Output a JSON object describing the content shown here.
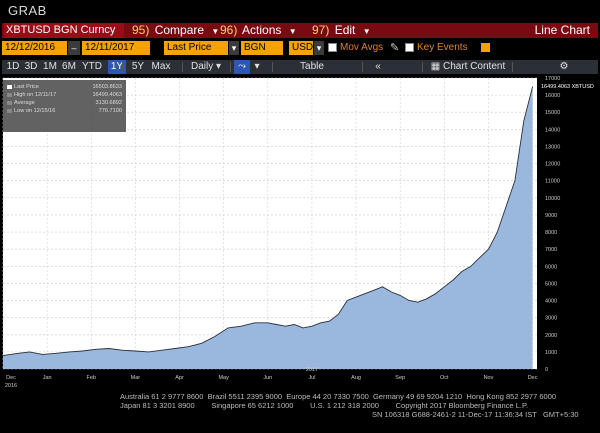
{
  "window": {
    "title": "GRAB"
  },
  "menu": {
    "ticker": "XBTUSD BGN Curncy",
    "compare_num": "95)",
    "compare_label": "Compare",
    "actions_num": "96)",
    "actions_label": "Actions",
    "edit_num": "97)",
    "edit_label": "Edit",
    "chart_title": "Line Chart"
  },
  "controls": {
    "start_date": "12/12/2016",
    "end_date": "12/11/2017",
    "field": "Last Price",
    "source": "BGN",
    "currency": "USD",
    "mov_avgs": "Mov Avgs",
    "key_events": "Key Events"
  },
  "periods": [
    "1D",
    "3D",
    "1M",
    "6M",
    "YTD",
    "1Y",
    "5Y",
    "Max"
  ],
  "active_period": "1Y",
  "frequency": "Daily",
  "table_label": "Table",
  "chart_content_label": "Chart Content",
  "legend": {
    "items": [
      {
        "label": "Last Price",
        "value": "16503.8633"
      },
      {
        "label": "High on 12/11/17",
        "value": "16499.4063"
      },
      {
        "label": "Average",
        "value": "3130.6892"
      },
      {
        "label": "Low on 12/15/16",
        "value": "776.7100"
      }
    ]
  },
  "last_label": "16499.4063 XBTUSD",
  "footer": {
    "line1": "Australia 61 2 9777 8600  Brazil 5511 2395 9000  Europe 44 20 7330 7500  Germany 49 69 9204 1210  Hong Kong 852 2977 6000",
    "line2": "Japan 81 3 3201 8900        Singapore 65 6212 1000        U.S. 1 212 318 2000        Copyright 2017 Bloomberg Finance L.P.",
    "line3": "SN 106318 G688-2461-2 11-Dec-17 11:36:34 IST   GMT+5:30"
  },
  "colors": {
    "area_fill": "#9ab8de",
    "line": "#2a2e3a",
    "orange": "#f5a300",
    "menu_red": "#7a0a12"
  },
  "chart_data": {
    "type": "area",
    "title": "",
    "xlabel": "",
    "ylabel": "",
    "ylim": [
      0,
      17000
    ],
    "y_ticks": [
      0,
      1000,
      2000,
      3000,
      4000,
      5000,
      6000,
      7000,
      8000,
      9000,
      10000,
      11000,
      12000,
      13000,
      14000,
      15000,
      16000,
      17000
    ],
    "x_ticks": [
      "Dec\n2016",
      "Jan",
      "Feb",
      "Mar",
      "Apr",
      "May",
      "Jun",
      "Jul\n2017",
      "Aug",
      "Sep",
      "Oct",
      "Nov",
      "Dec"
    ],
    "x_tick_positions": [
      0,
      1,
      2,
      3,
      4,
      5,
      6,
      7,
      8,
      9,
      10,
      11,
      12
    ],
    "x": [
      0,
      0.3,
      0.6,
      0.9,
      1.2,
      1.5,
      1.8,
      2.1,
      2.4,
      2.7,
      3.0,
      3.3,
      3.6,
      3.9,
      4.2,
      4.5,
      4.8,
      5.1,
      5.4,
      5.7,
      6.0,
      6.2,
      6.4,
      6.6,
      6.8,
      7.0,
      7.2,
      7.4,
      7.6,
      7.8,
      8.0,
      8.2,
      8.4,
      8.6,
      8.8,
      9.0,
      9.2,
      9.4,
      9.6,
      9.8,
      10.0,
      10.2,
      10.4,
      10.6,
      10.8,
      11.0,
      11.2,
      11.4,
      11.6,
      11.8,
      11.9,
      12.0
    ],
    "values": [
      780,
      900,
      1000,
      850,
      920,
      1000,
      1050,
      1150,
      1200,
      1100,
      1050,
      1000,
      1100,
      1200,
      1300,
      1500,
      1900,
      2400,
      2500,
      2700,
      2700,
      2600,
      2500,
      2600,
      2400,
      2500,
      2700,
      2800,
      3200,
      4000,
      4200,
      4400,
      4600,
      4800,
      4500,
      4300,
      4000,
      3900,
      4100,
      4400,
      4800,
      5200,
      5700,
      6000,
      6500,
      7000,
      8000,
      9500,
      11000,
      14500,
      15500,
      16500
    ],
    "series": [
      {
        "name": "XBTUSD",
        "values": []
      }
    ],
    "grid": true,
    "legend_position": "top-left"
  }
}
